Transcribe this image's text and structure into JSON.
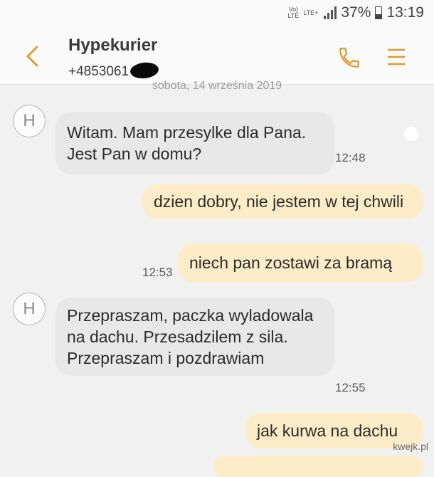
{
  "status_bar": {
    "volte": "Vo)\nLTE",
    "lte_plus": "LTE+",
    "battery": "37%",
    "time": "13:19"
  },
  "header": {
    "contact_name": "Hypekurier",
    "contact_number": "+4853061"
  },
  "date_separator": "sobota, 14 września 2019",
  "messages": [
    {
      "direction": "incoming",
      "avatar": "H",
      "text": "Witam. Mam przesylke dla Pana. Jest Pan w domu?",
      "time": "12:48"
    },
    {
      "direction": "outgoing",
      "text": "dzien dobry, nie jestem w tej chwili",
      "time": ""
    },
    {
      "direction": "outgoing",
      "text": "niech pan zostawi za bramą",
      "time": "12:53"
    },
    {
      "direction": "incoming",
      "avatar": "H",
      "text": "Przepraszam, paczka wyladowala na dachu. Przesadzilem z sila. Przepraszam i pozdrawiam",
      "time": "12:55"
    },
    {
      "direction": "outgoing",
      "text": "jak kurwa na dachu",
      "time": ""
    }
  ],
  "watermark": "kwejk.pl",
  "icons": [
    "back-arrow-icon",
    "phone-icon",
    "menu-icon",
    "signal-icon",
    "battery-icon"
  ],
  "colors": {
    "accent": "#e39a2d",
    "outgoing_bubble": "#fcedc8",
    "incoming_bubble": "#e8e8e8",
    "background": "#f1f1f1"
  }
}
